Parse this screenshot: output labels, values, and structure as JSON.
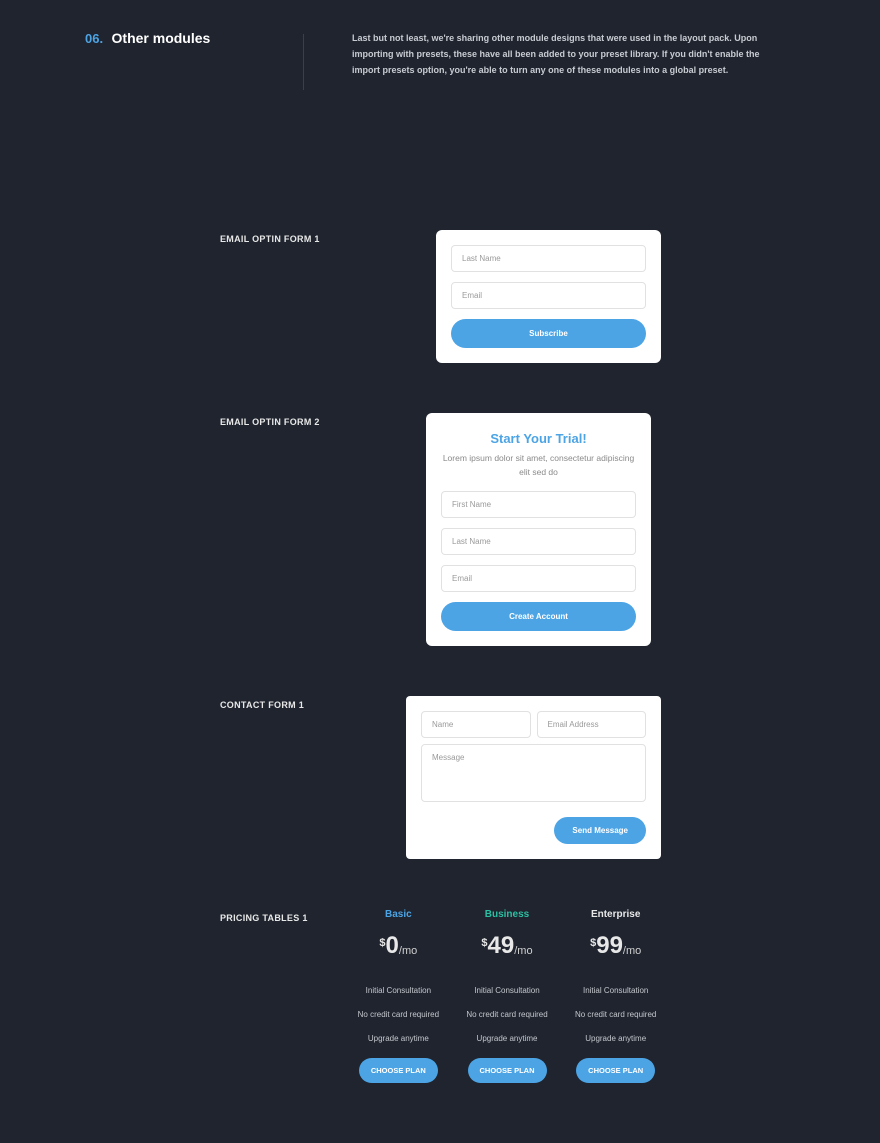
{
  "header": {
    "num": "06.",
    "title": "Other modules",
    "desc": "Last but not least, we're sharing other module designs that were used in the layout pack. Upon importing with presets, these have all been added to your preset library. If you didn't enable the import presets option, you're able to turn any one of these modules into a global preset."
  },
  "labels": {
    "optin1": "EMAIL OPTIN FORM 1",
    "optin2": "EMAIL OPTIN FORM 2",
    "contact1": "CONTACT FORM 1",
    "pricing1": "PRICING TABLES 1"
  },
  "optin1": {
    "lastname_ph": "Last Name",
    "email_ph": "Email",
    "button": "Subscribe"
  },
  "optin2": {
    "title": "Start Your Trial!",
    "sub": "Lorem ipsum dolor sit amet, consectetur adipiscing elit sed do",
    "firstname_ph": "First Name",
    "lastname_ph": "Last Name",
    "email_ph": "Email",
    "button": "Create Account"
  },
  "contact": {
    "name_ph": "Name",
    "email_ph": "Email Address",
    "message_ph": "Message",
    "button": "Send Message"
  },
  "pricing": {
    "plans": [
      {
        "name": "Basic",
        "price": "0"
      },
      {
        "name": "Business",
        "price": "49"
      },
      {
        "name": "Enterprise",
        "price": "99"
      }
    ],
    "currency": "$",
    "period": "/mo",
    "features": [
      "Initial Consultation",
      "No credit card required",
      "Upgrade anytime"
    ],
    "cta": "CHOOSE PLAN"
  }
}
